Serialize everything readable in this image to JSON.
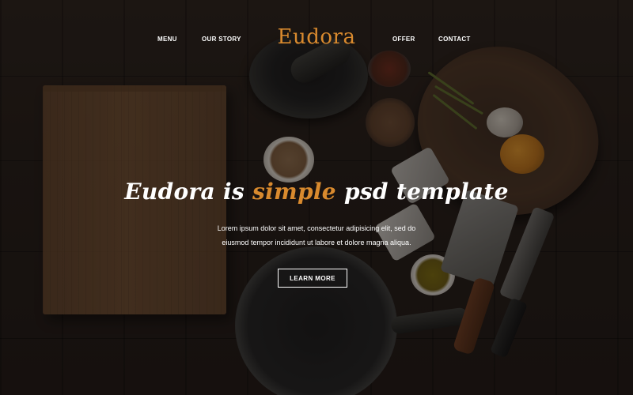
{
  "nav": {
    "menu": "MENU",
    "our_story": "OUR STORY",
    "logo": "Eudora",
    "offer": "OFFER",
    "contact": "CONTACT"
  },
  "hero": {
    "headline_pre": "Eudora is",
    "headline_accent": "simple",
    "headline_post": "psd template",
    "desc_line1": "Lorem ipsum dolor sit amet, consectetur adipisicing elit, sed do",
    "desc_line2": "eiusmod tempor incididunt ut labore et dolore magna aliqua.",
    "cta": "LEARN MORE"
  },
  "colors": {
    "accent": "#d98a2e",
    "text": "#ffffff",
    "background": "#1a1410"
  }
}
